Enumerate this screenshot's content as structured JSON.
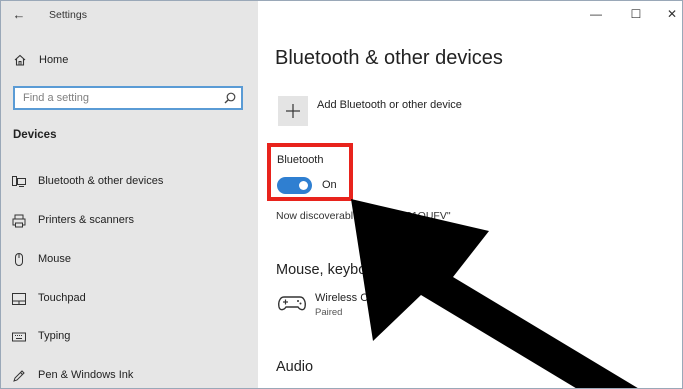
{
  "window": {
    "title": "Settings",
    "back_icon": "back-arrow-icon",
    "controls": {
      "minimize": "—",
      "maximize": "☐",
      "close": "✕"
    }
  },
  "sidebar": {
    "home_label": "Home",
    "search": {
      "placeholder": "Find a setting"
    },
    "section_header": "Devices",
    "items": [
      {
        "label": "Bluetooth & other devices",
        "icon": "bluetooth-devices-icon"
      },
      {
        "label": "Printers & scanners",
        "icon": "printer-icon"
      },
      {
        "label": "Mouse",
        "icon": "mouse-icon"
      },
      {
        "label": "Touchpad",
        "icon": "touchpad-icon"
      },
      {
        "label": "Typing",
        "icon": "keyboard-icon"
      },
      {
        "label": "Pen & Windows Ink",
        "icon": "pen-icon"
      }
    ]
  },
  "main": {
    "page_title": "Bluetooth & other devices",
    "add_device_label": "Add Bluetooth or other device",
    "bluetooth": {
      "label": "Bluetooth",
      "toggle_state": "On",
      "is_on": true
    },
    "discoverable_text": "Now discoverabl",
    "device_id_text": "E81OUFV\"",
    "mouse_section_title": "Mouse, keyboar",
    "device": {
      "name": "Wireless Controlle",
      "status": "Paired",
      "icon": "gamepad-icon"
    },
    "audio_section_title": "Audio"
  },
  "colors": {
    "sidebar_bg": "#e6e6e6",
    "accent": "#2f7fd1",
    "highlight_border": "#e8231c",
    "search_border": "#5a9bd5",
    "arrow": "#000000"
  }
}
